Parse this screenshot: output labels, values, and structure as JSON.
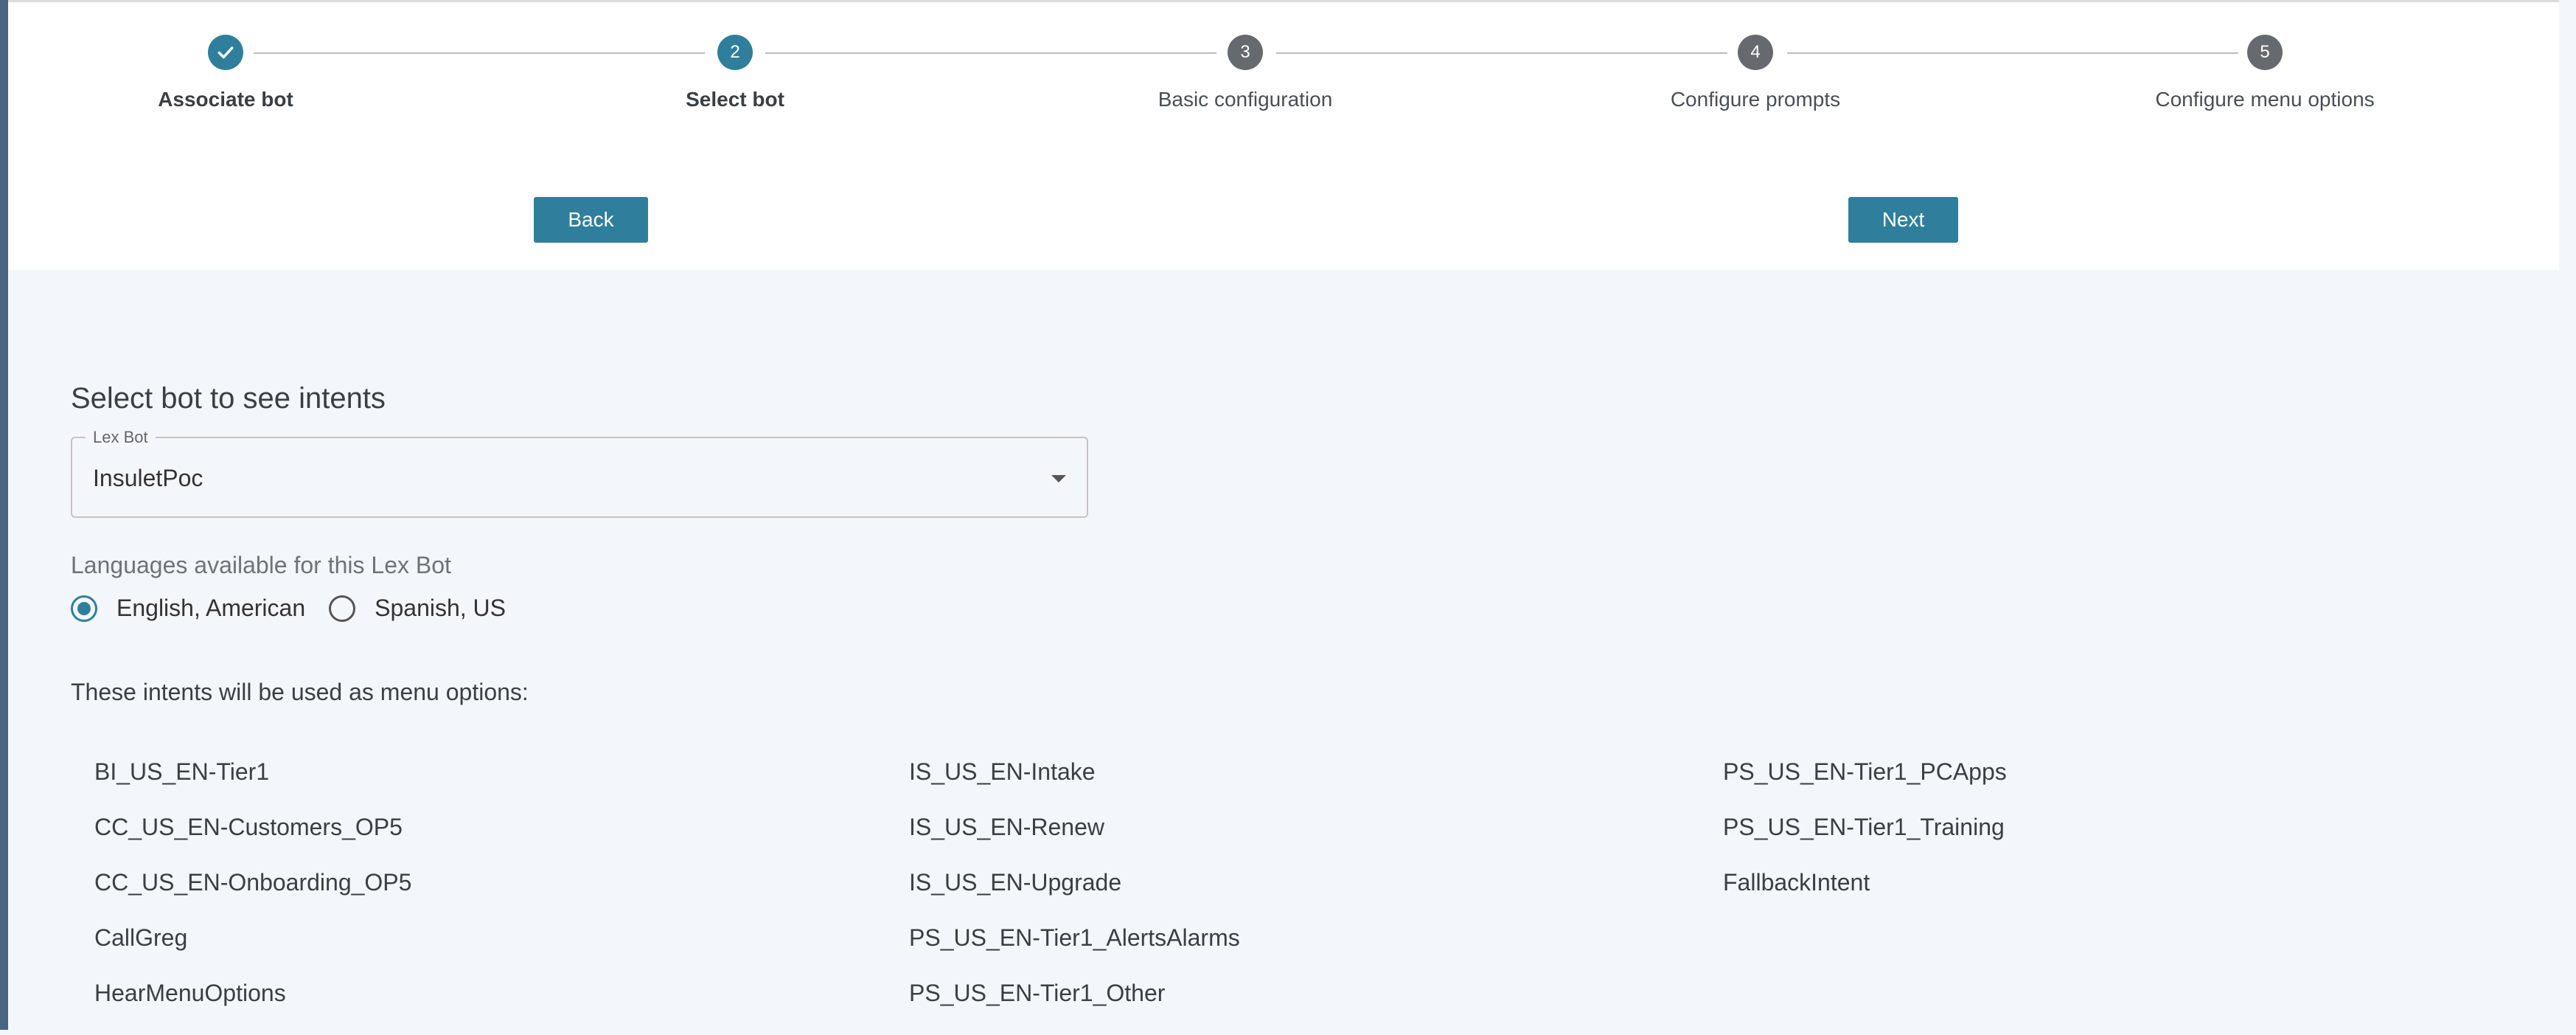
{
  "wizard": {
    "steps": [
      {
        "number": "✓",
        "label": "Associate bot",
        "state": "done"
      },
      {
        "number": "2",
        "label": "Select bot",
        "state": "active"
      },
      {
        "number": "3",
        "label": "Basic configuration",
        "state": "pending"
      },
      {
        "number": "4",
        "label": "Configure prompts",
        "state": "pending"
      },
      {
        "number": "5",
        "label": "Configure menu options",
        "state": "pending"
      }
    ],
    "back_label": "Back",
    "next_label": "Next"
  },
  "main": {
    "title": "Select bot to see intents",
    "lex_bot": {
      "legend": "Lex Bot",
      "value": "InsuletPoc"
    },
    "languages_caption": "Languages available for this Lex Bot",
    "languages": [
      {
        "label": "English, American",
        "selected": true
      },
      {
        "label": "Spanish, US",
        "selected": false
      }
    ],
    "intents_caption": "These intents will be used as menu options:",
    "intents": {
      "col1": [
        "BI_US_EN-Tier1",
        "CC_US_EN-Customers_OP5",
        "CC_US_EN-Onboarding_OP5",
        "CallGreg",
        "HearMenuOptions"
      ],
      "col2": [
        "IS_US_EN-Intake",
        "IS_US_EN-Renew",
        "IS_US_EN-Upgrade",
        "PS_US_EN-Tier1_AlertsAlarms",
        "PS_US_EN-Tier1_Other"
      ],
      "col3": [
        "PS_US_EN-Tier1_PCApps",
        "PS_US_EN-Tier1_Training",
        "FallbackIntent"
      ]
    }
  },
  "colors": {
    "accent": "#2f7f9c",
    "pending_step": "#666a6e",
    "background": "#f3f6fb"
  }
}
